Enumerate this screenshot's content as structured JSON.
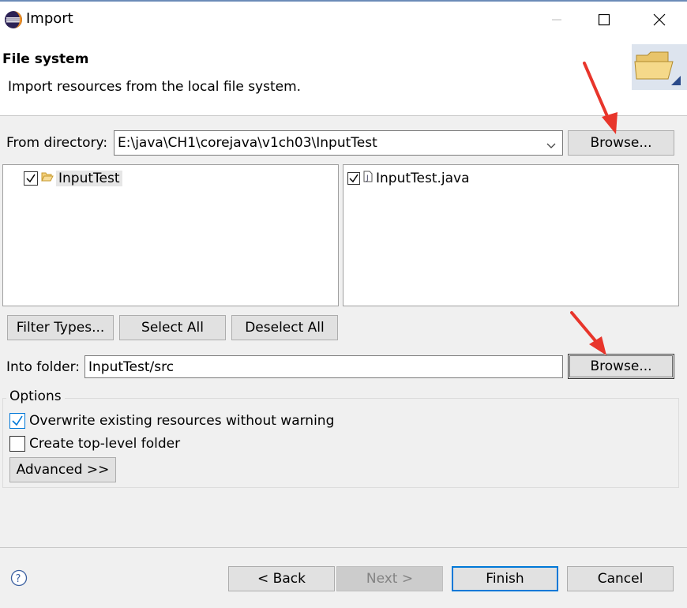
{
  "window": {
    "title": "Import"
  },
  "header": {
    "title": "File system",
    "description": "Import resources from the local file system."
  },
  "from_directory": {
    "label": "From directory:",
    "value": "E:\\java\\CH1\\corejava\\v1ch03\\InputTest",
    "browse_label": "Browse..."
  },
  "folder_tree": [
    {
      "label": "InputTest",
      "checked": true,
      "icon": "folder-open-icon"
    }
  ],
  "file_list": [
    {
      "label": "InputTest.java",
      "checked": true,
      "icon": "java-file-icon"
    }
  ],
  "selection_buttons": {
    "filter_types": "Filter Types...",
    "select_all": "Select All",
    "deselect_all": "Deselect All"
  },
  "into_folder": {
    "label": "Into folder:",
    "value": "InputTest/src",
    "browse_label": "Browse..."
  },
  "options": {
    "legend": "Options",
    "overwrite": {
      "label": "Overwrite existing resources without warning",
      "checked": true
    },
    "create_top_level": {
      "label": "Create top-level folder",
      "checked": false
    },
    "advanced": "Advanced >>"
  },
  "footer": {
    "help_icon": "help-icon",
    "back": "< Back",
    "next": "Next >",
    "finish": "Finish",
    "cancel": "Cancel"
  },
  "colors": {
    "accent": "#0078d7",
    "annotation_arrow": "#e8352b"
  }
}
